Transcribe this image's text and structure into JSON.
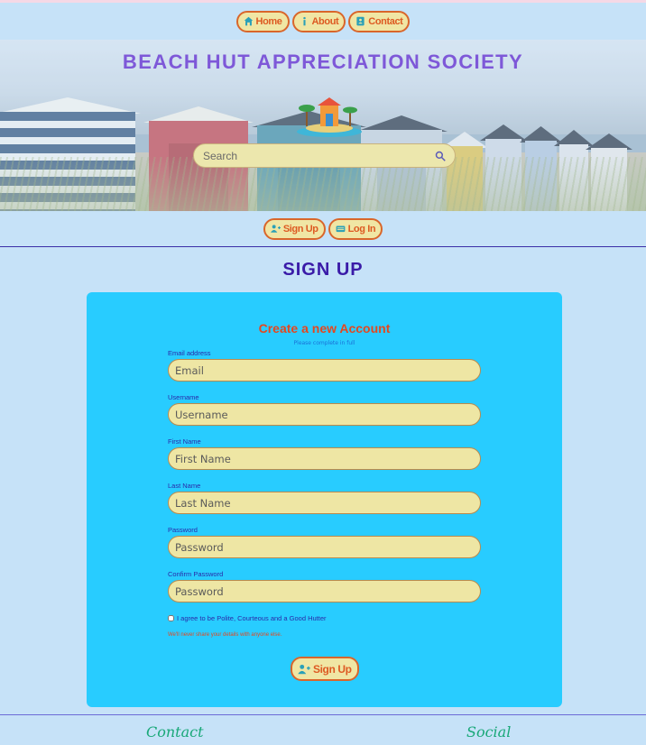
{
  "nav": {
    "home": "Home",
    "about": "About",
    "contact": "Contact"
  },
  "hero": {
    "title": "BEACH HUT APPRECIATION SOCIETY",
    "search_placeholder": "Search"
  },
  "auth_nav": {
    "signup": "Sign Up",
    "login": "Log In"
  },
  "page": {
    "heading": "SIGN UP"
  },
  "form": {
    "title": "Create a new Account",
    "subtitle": "Please complete in full",
    "fields": [
      {
        "label": "Email address",
        "placeholder": "Email"
      },
      {
        "label": "Username",
        "placeholder": "Username"
      },
      {
        "label": "First Name",
        "placeholder": "First Name"
      },
      {
        "label": "Last Name",
        "placeholder": "Last Name"
      },
      {
        "label": "Password",
        "placeholder": "Password"
      },
      {
        "label": "Confirm Password",
        "placeholder": "Password"
      }
    ],
    "agree_label": "I agree to be Polite, Courteous and a Good Hutter",
    "privacy_note": "We'll never share your details with anyone else.",
    "submit_label": "Sign Up"
  },
  "footer": {
    "contact": "Contact",
    "social": "Social"
  },
  "colors": {
    "page_bg": "#c6e2f8",
    "card_bg": "#28ccff",
    "pill_bg": "#f0e6a4",
    "accent_orange": "#dd5a22",
    "title_purple": "#7e58d8",
    "heading_indigo": "#3a1ba8",
    "footer_green": "#19a878"
  },
  "icons": {
    "home": "house-icon",
    "about": "info-icon",
    "contact": "address-book-icon",
    "search": "search-icon",
    "signup": "user-plus-icon",
    "login": "id-card-icon"
  }
}
